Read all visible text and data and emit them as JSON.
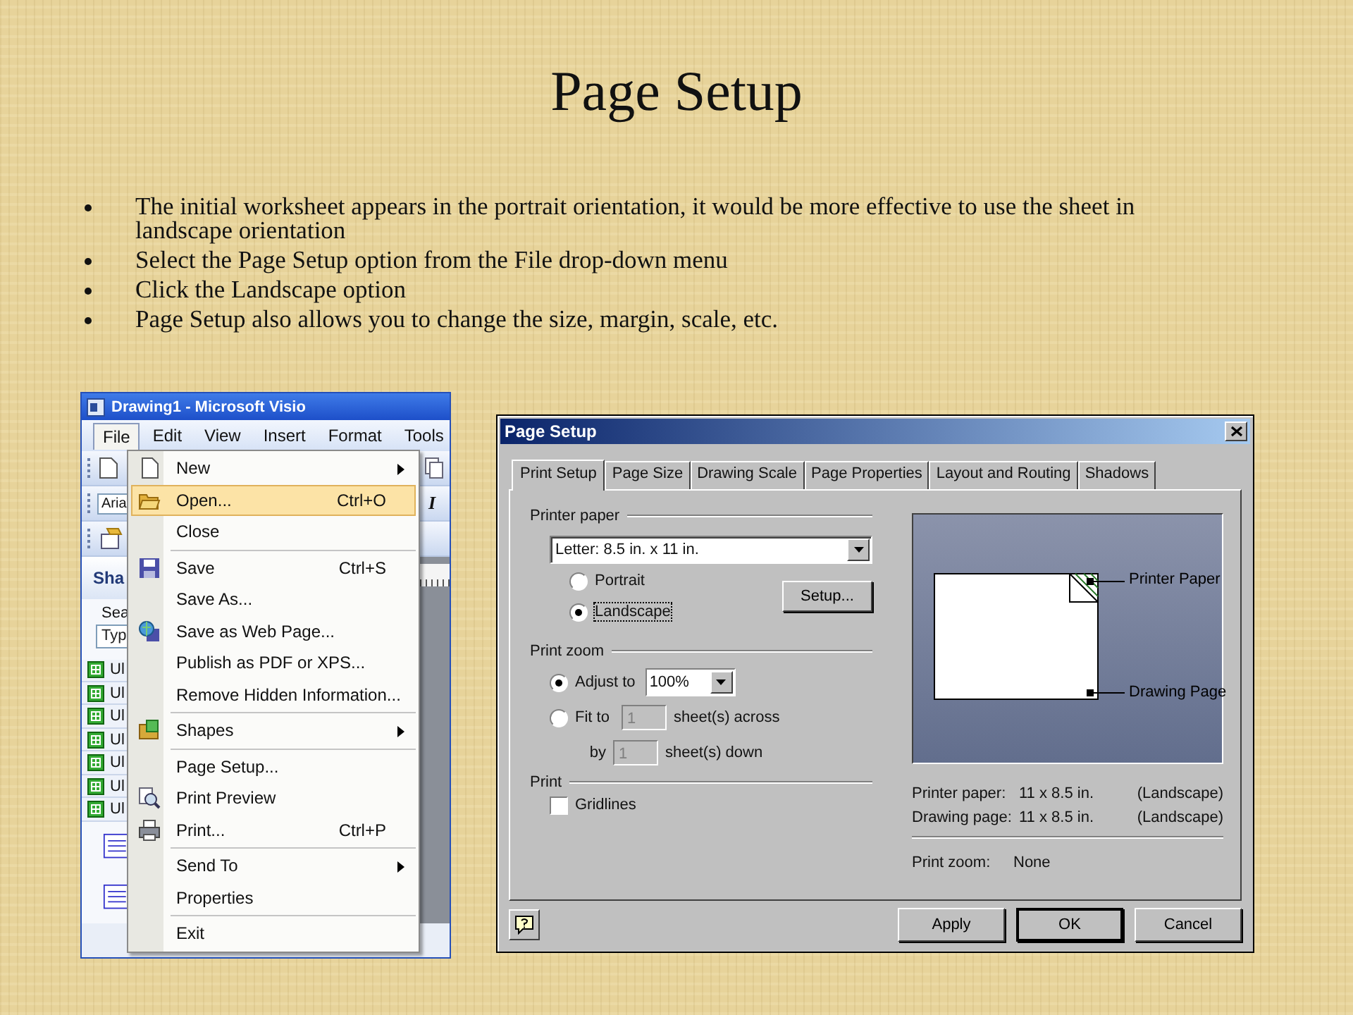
{
  "slide": {
    "title": "Page Setup",
    "bullets": [
      "The initial worksheet appears in the portrait orientation, it would be more effective to use the sheet in landscape orientation",
      "Select the Page Setup option from the File drop-down menu",
      "Click the Landscape option",
      "Page Setup also allows you to change the size, margin, scale, etc."
    ]
  },
  "visio_window": {
    "title": "Drawing1 - Microsoft Visio",
    "menubar": [
      {
        "label": "File",
        "selected": true
      },
      {
        "label": "Edit",
        "selected": false
      },
      {
        "label": "View",
        "selected": false
      },
      {
        "label": "Insert",
        "selected": false
      },
      {
        "label": "Format",
        "selected": false
      },
      {
        "label": "Tools",
        "selected": false
      }
    ],
    "font_field": {
      "value": "Aria"
    },
    "italic_button": "I",
    "shapes_panel": {
      "title": "Sha",
      "search_label": "Sea",
      "search_field": {
        "placeholder": "Typ"
      },
      "stencils": [
        "Ul",
        "Ul",
        "Ul",
        "Ul",
        "Ul",
        "Ul",
        "Ul"
      ]
    },
    "file_menu": [
      {
        "label": "New",
        "submenu": true,
        "separator_before": false,
        "selected": false
      },
      {
        "label": "Open...",
        "shortcut": "Ctrl+O",
        "separator_before": false,
        "selected": true
      },
      {
        "label": "Close",
        "separator_before": false,
        "selected": false
      },
      {
        "label": "Save",
        "shortcut": "Ctrl+S",
        "separator_before": true,
        "selected": false
      },
      {
        "label": "Save As...",
        "separator_before": false,
        "selected": false
      },
      {
        "label": "Save as Web Page...",
        "separator_before": false,
        "selected": false
      },
      {
        "label": "Publish as PDF or XPS...",
        "separator_before": false,
        "selected": false
      },
      {
        "label": "Remove Hidden Information...",
        "separator_before": false,
        "selected": false
      },
      {
        "label": "Shapes",
        "submenu": true,
        "separator_before": true,
        "selected": false
      },
      {
        "label": "Page Setup...",
        "separator_before": true,
        "selected": false
      },
      {
        "label": "Print Preview",
        "separator_before": false,
        "selected": false
      },
      {
        "label": "Print...",
        "shortcut": "Ctrl+P",
        "separator_before": false,
        "selected": false
      },
      {
        "label": "Send To",
        "submenu": true,
        "separator_before": true,
        "selected": false
      },
      {
        "label": "Properties",
        "separator_before": false,
        "selected": false
      },
      {
        "label": "Exit",
        "separator_before": true,
        "selected": false
      }
    ]
  },
  "page_setup_dialog": {
    "title": "Page Setup",
    "tabs": [
      {
        "label": "Print Setup",
        "selected": true
      },
      {
        "label": "Page Size",
        "selected": false
      },
      {
        "label": "Drawing Scale",
        "selected": false
      },
      {
        "label": "Page Properties",
        "selected": false
      },
      {
        "label": "Layout and Routing",
        "selected": false
      },
      {
        "label": "Shadows",
        "selected": false
      }
    ],
    "printer_paper": {
      "label": "Printer paper",
      "paper_select": {
        "value": "Letter:  8.5 in. x 11 in."
      },
      "orientations": [
        {
          "label": "Portrait",
          "selected": false
        },
        {
          "label": "Landscape",
          "selected": true
        }
      ],
      "setup_button": "Setup..."
    },
    "print_zoom": {
      "label": "Print zoom",
      "modes": [
        {
          "kind": "adjust",
          "label": "Adjust to",
          "selected": true,
          "value": "100%"
        },
        {
          "kind": "fit",
          "label": "Fit to",
          "selected": false,
          "fields": [
            {
              "value": "1",
              "suffix": "sheet(s) across",
              "disabled": true
            },
            {
              "prefix": "by",
              "value": "1",
              "suffix": "sheet(s) down",
              "disabled": true
            }
          ]
        }
      ]
    },
    "print": {
      "label": "Print",
      "gridlines": {
        "label": "Gridlines",
        "checked": false
      }
    },
    "preview": {
      "printer_paper_label": "Printer Paper",
      "drawing_page_label": "Drawing Page"
    },
    "info": [
      {
        "label": "Printer paper:",
        "value": "11 x 8.5 in.",
        "orientation": "(Landscape)"
      },
      {
        "label": "Drawing page:",
        "value": "11 x 8.5 in.",
        "orientation": "(Landscape)"
      }
    ],
    "zoom_info": {
      "label": "Print zoom:",
      "value": "None"
    },
    "buttons": [
      {
        "label": "Apply",
        "default": false
      },
      {
        "label": "OK",
        "default": true
      },
      {
        "label": "Cancel",
        "default": false
      }
    ]
  }
}
